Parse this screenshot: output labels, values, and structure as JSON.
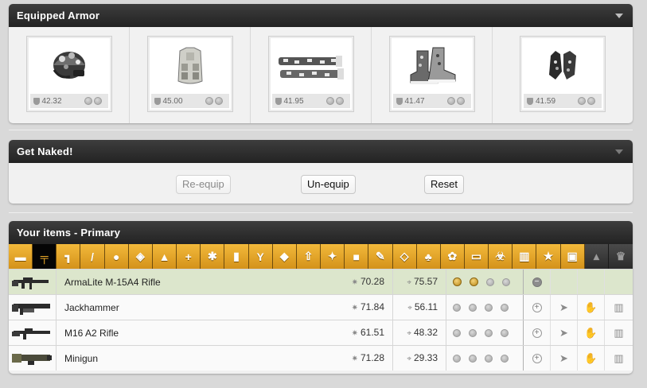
{
  "armor": {
    "title": "Equipped Armor",
    "slots": [
      {
        "icon": "helmet-icon",
        "value": "42.32"
      },
      {
        "icon": "vest-icon",
        "value": "45.00"
      },
      {
        "icon": "pants-icon",
        "value": "41.95"
      },
      {
        "icon": "boots-icon",
        "value": "41.47"
      },
      {
        "icon": "gloves-icon",
        "value": "41.59"
      }
    ]
  },
  "naked": {
    "title": "Get Naked!",
    "reequip": "Re-equip",
    "unequip": "Un-equip",
    "reset": "Reset"
  },
  "items": {
    "title": "Your items - Primary",
    "categories": [
      "folder-icon",
      "primary-weapon-icon",
      "secondary-weapon-icon",
      "melee-icon",
      "grenade-icon",
      "defensive-icon",
      "armor-icon",
      "medical-icon",
      "drug-icon",
      "booster-icon",
      "alcohol-icon",
      "candy-icon",
      "energy-icon",
      "enhancer-icon",
      "supply-pack-icon",
      "tool-icon",
      "jewelry-icon",
      "flower-icon",
      "plushie-icon",
      "car-icon",
      "virus-icon",
      "collectible-icon",
      "special-icon",
      "bag-icon",
      "pyramid-icon",
      "trophy-icon"
    ],
    "rows": [
      {
        "name": "ArmaLite M-15A4 Rifle",
        "damage": "70.28",
        "accuracy": "75.57",
        "mods": 2,
        "selected": true
      },
      {
        "name": "Jackhammer",
        "damage": "71.84",
        "accuracy": "56.11",
        "mods": 0,
        "selected": false
      },
      {
        "name": "M16 A2 Rifle",
        "damage": "61.51",
        "accuracy": "48.32",
        "mods": 0,
        "selected": false
      },
      {
        "name": "Minigun",
        "damage": "71.28",
        "accuracy": "29.33",
        "mods": 0,
        "selected": false
      }
    ]
  },
  "colors": {
    "header": "#2d2d2d",
    "accent": "#e6a52a",
    "selected_row": "#dce6cc"
  }
}
